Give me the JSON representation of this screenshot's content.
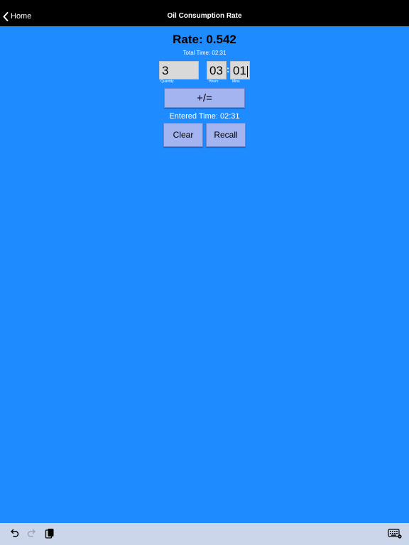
{
  "nav": {
    "back_label": "Home",
    "title": "Oil Consumption Rate"
  },
  "main": {
    "rate": "Rate: 0.542",
    "total_time": "Total Time: 02:31",
    "quantity": {
      "value": "3",
      "label": "Quantity"
    },
    "hours": {
      "value": "03",
      "label": "Hours"
    },
    "mins": {
      "value": "01",
      "label": "Mins"
    },
    "colon": ":",
    "plus_equals_label": "+/=",
    "entered_time": "Entered Time: 02:31",
    "clear_label": "Clear",
    "recall_label": "Recall"
  },
  "colors": {
    "background": "#1e8cff",
    "navbar": "#000000",
    "button": "#a3b4f0",
    "field": "#d9d9d9",
    "toolbar": "#cbd6ea"
  },
  "toolbar": {
    "icons": [
      "undo-icon",
      "redo-icon",
      "paste-icon",
      "keyboard-dismiss-icon"
    ]
  }
}
